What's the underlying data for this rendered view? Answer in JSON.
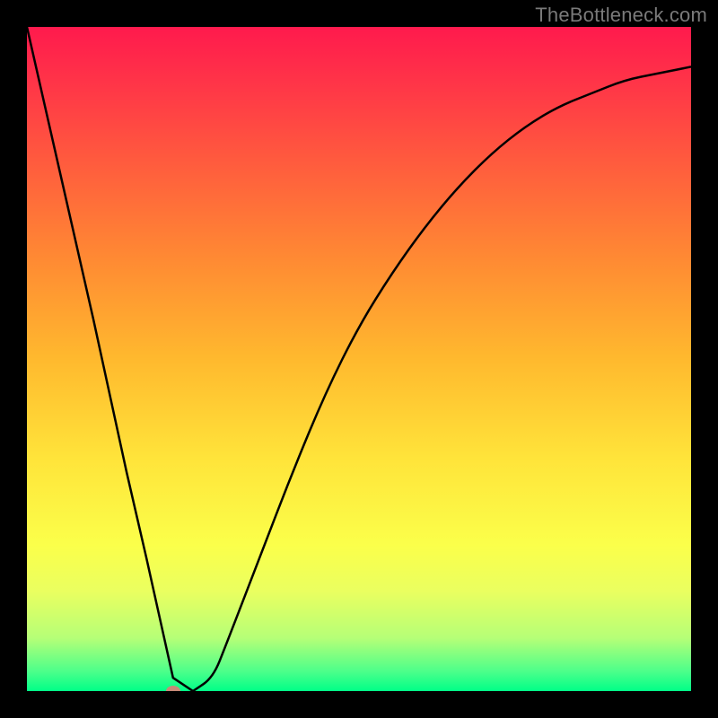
{
  "watermark": "TheBottleneck.com",
  "chart_data": {
    "type": "line",
    "title": "",
    "xlabel": "",
    "ylabel": "",
    "xlim": [
      0,
      100
    ],
    "ylim": [
      0,
      100
    ],
    "grid": false,
    "legend": false,
    "series": [
      {
        "name": "curve",
        "x": [
          0,
          5,
          10,
          15,
          18,
          20,
          22,
          25,
          28,
          30,
          35,
          40,
          45,
          50,
          55,
          60,
          65,
          70,
          75,
          80,
          85,
          90,
          95,
          100
        ],
        "y": [
          100,
          78,
          56,
          33,
          20,
          11,
          2,
          0,
          2,
          7,
          20,
          33,
          45,
          55,
          63,
          70,
          76,
          81,
          85,
          88,
          90,
          92,
          93,
          94
        ]
      }
    ],
    "marker": {
      "x": 22,
      "y": 0
    },
    "background": "rainbow-gradient-vertical"
  },
  "frame": {
    "outer_size_px": 800,
    "border_px": 30,
    "border_color": "#000000"
  }
}
